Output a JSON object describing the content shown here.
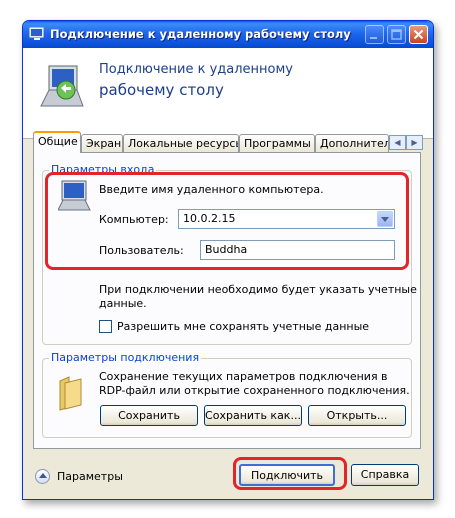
{
  "window": {
    "title": "Подключение к удаленному рабочему столу",
    "header_line1": "Подключение к удаленному",
    "header_line2": "рабочему столу"
  },
  "tabs": [
    {
      "label": "Общие",
      "active": true
    },
    {
      "label": "Экран"
    },
    {
      "label": "Локальные ресурсы"
    },
    {
      "label": "Программы"
    },
    {
      "label": "Дополнительно"
    }
  ],
  "login_group": {
    "label": "Параметры входа",
    "prompt": "Введите имя удаленного компьютера.",
    "computer_label": "Компьютер:",
    "computer_value": "10.0.2.15",
    "user_label": "Пользователь:",
    "user_value": "Buddha",
    "note": "При подключении необходимо будет указать учетные",
    "note_line2": "данные.",
    "save_credentials_label": "Разрешить мне сохранять учетные данные"
  },
  "connection_group": {
    "label": "Параметры подключения",
    "description_line1": "Сохранение текущих параметров подключения в",
    "description_line2": "RDP-файл или открытие сохраненного подключения.",
    "save_label": "Сохранить",
    "save_as_label": "Сохранить как...",
    "open_label": "Открыть..."
  },
  "footer": {
    "options_label": "Параметры",
    "connect_label": "Подключить",
    "help_label": "Справка"
  },
  "colors": {
    "titlebar": "#0b4fd8",
    "highlight": "#e3242b",
    "group_label": "#0046d5",
    "header_text": "#1b3e8d"
  }
}
